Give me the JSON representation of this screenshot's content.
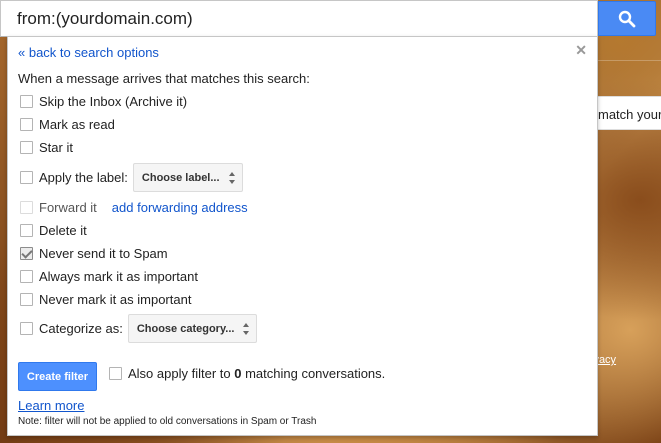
{
  "search": {
    "query": "from:(yourdomain.com)",
    "button_icon": "search-icon"
  },
  "background": {
    "panel_text": "match your",
    "privacy_text": "Privacy"
  },
  "filter": {
    "back_link": "« back to search options",
    "close_icon": "close-icon",
    "intro": "When a message arrives that matches this search:",
    "options": {
      "skip_inbox": {
        "label": "Skip the Inbox (Archive it)",
        "checked": false
      },
      "mark_read": {
        "label": "Mark as read",
        "checked": false
      },
      "star": {
        "label": "Star it",
        "checked": false
      },
      "apply_label": {
        "label": "Apply the label:",
        "select_value": "Choose label...",
        "checked": false
      },
      "forward": {
        "label": "Forward it",
        "link": "add forwarding address",
        "checked": false,
        "disabled": true
      },
      "delete": {
        "label": "Delete it",
        "checked": false
      },
      "never_spam": {
        "label": "Never send it to Spam",
        "checked": true
      },
      "always_important": {
        "label": "Always mark it as important",
        "checked": false
      },
      "never_important": {
        "label": "Never mark it as important",
        "checked": false
      },
      "categorize": {
        "label": "Categorize as:",
        "select_value": "Choose category...",
        "checked": false
      }
    },
    "create_button": "Create filter",
    "apply_prefix": "Also apply filter to",
    "apply_count": "0",
    "apply_suffix": "matching conversations.",
    "learn_more": "Learn more",
    "note": "Note: filter will not be applied to old conversations in Spam or Trash"
  },
  "colors": {
    "accent_blue": "#4d90fe",
    "link_blue": "#1155cc"
  }
}
